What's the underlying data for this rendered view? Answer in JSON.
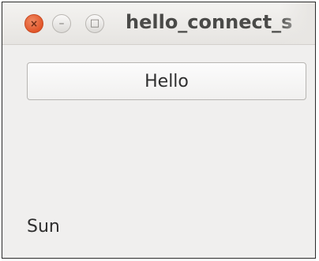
{
  "window": {
    "title": "hello_connect_s",
    "controls": {
      "close_glyph": "×",
      "minimize_glyph": "–",
      "maximize_glyph": "□"
    }
  },
  "main": {
    "button_label": "Hello",
    "label_text": "Sun"
  },
  "colors": {
    "close_button": "#e2562a",
    "window_background": "#f0efee",
    "titlebar_background": "#e6e4e1",
    "text": "#2e2e2e"
  }
}
